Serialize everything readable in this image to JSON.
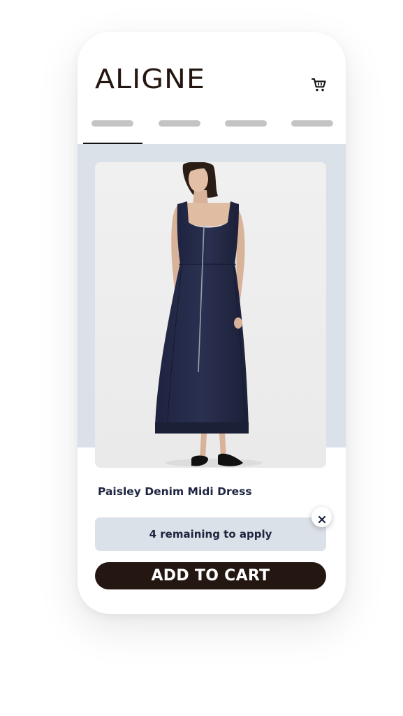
{
  "header": {
    "brand": "ALIGNE",
    "cart_icon": "shopping-cart-icon"
  },
  "tabs": [
    {
      "label": "",
      "active": true
    },
    {
      "label": "",
      "active": false
    },
    {
      "label": "",
      "active": false
    },
    {
      "label": "",
      "active": false
    }
  ],
  "product": {
    "name": "Paisley Denim Midi Dress",
    "image": "navy-denim-midi-dress-photo",
    "remaining_text": "4 remaining to apply",
    "add_to_cart_label": "ADD TO CART",
    "close_icon": "close-icon"
  },
  "colors": {
    "brand": "#241611",
    "accent_bg": "#dbe1e8",
    "text_navy": "#1d2540",
    "denim": "#252a45"
  }
}
